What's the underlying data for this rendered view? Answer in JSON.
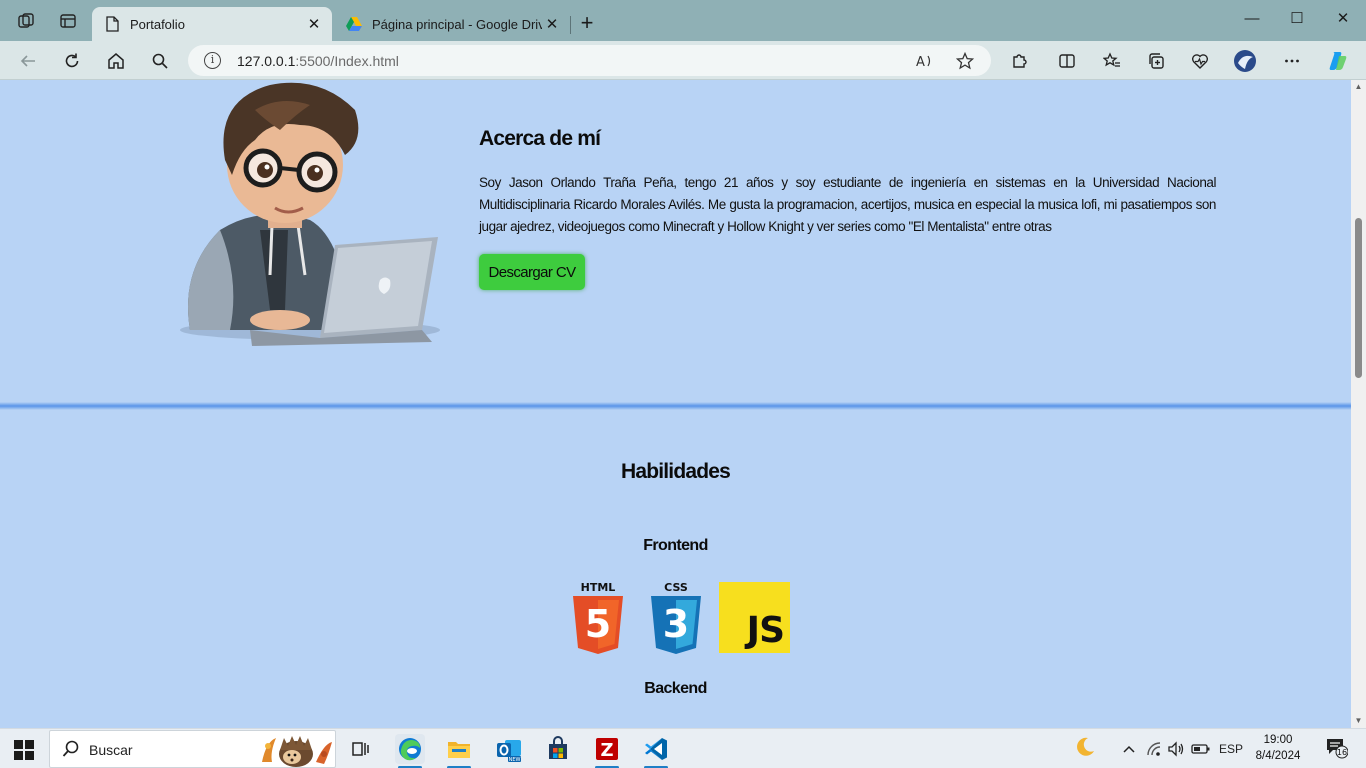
{
  "browser": {
    "tabs": [
      {
        "title": "Portafolio",
        "active": true
      },
      {
        "title": "Página principal - Google Drive",
        "active": false
      }
    ],
    "url_host": "127.0.0.1",
    "url_rest": ":5500/Index.html",
    "close_glyph": "✕",
    "new_tab_glyph": "+",
    "minimize_glyph": "—",
    "maximize_glyph": "☐",
    "win_close_glyph": "✕"
  },
  "about": {
    "title": "Acerca de mí",
    "text": "Soy Jason Orlando Traña Peña, tengo 21 años y soy estudiante de ingeniería en sistemas en la Universidad Nacional Multidisciplinaria Ricardo Morales Avilés. Me gusta la programacion, acertijos, musica en especial la musica lofi, mi pasatiempos son jugar ajedrez, videojuegos como Minecraft y Hollow Knight y ver series como \"El Mentalista\" entre otras",
    "cv_button": "Descargar CV"
  },
  "skills": {
    "title": "Habilidades",
    "frontend_title": "Frontend",
    "backend_title": "Backend",
    "frontend_logos": [
      {
        "name": "HTML",
        "badge": "5",
        "color": "#e44d26"
      },
      {
        "name": "CSS",
        "badge": "3",
        "color": "#1572b6"
      },
      {
        "name": "JS",
        "badge": "JS",
        "color": "#f7df1e"
      }
    ]
  },
  "taskbar": {
    "search_label": "Buscar",
    "language": "ESP",
    "time": "19:00",
    "date": "8/4/2024",
    "notification_count": "16",
    "apps": [
      "task-view",
      "edge",
      "file-explorer",
      "outlook",
      "microsoft-store",
      "filezilla",
      "vscode"
    ]
  }
}
